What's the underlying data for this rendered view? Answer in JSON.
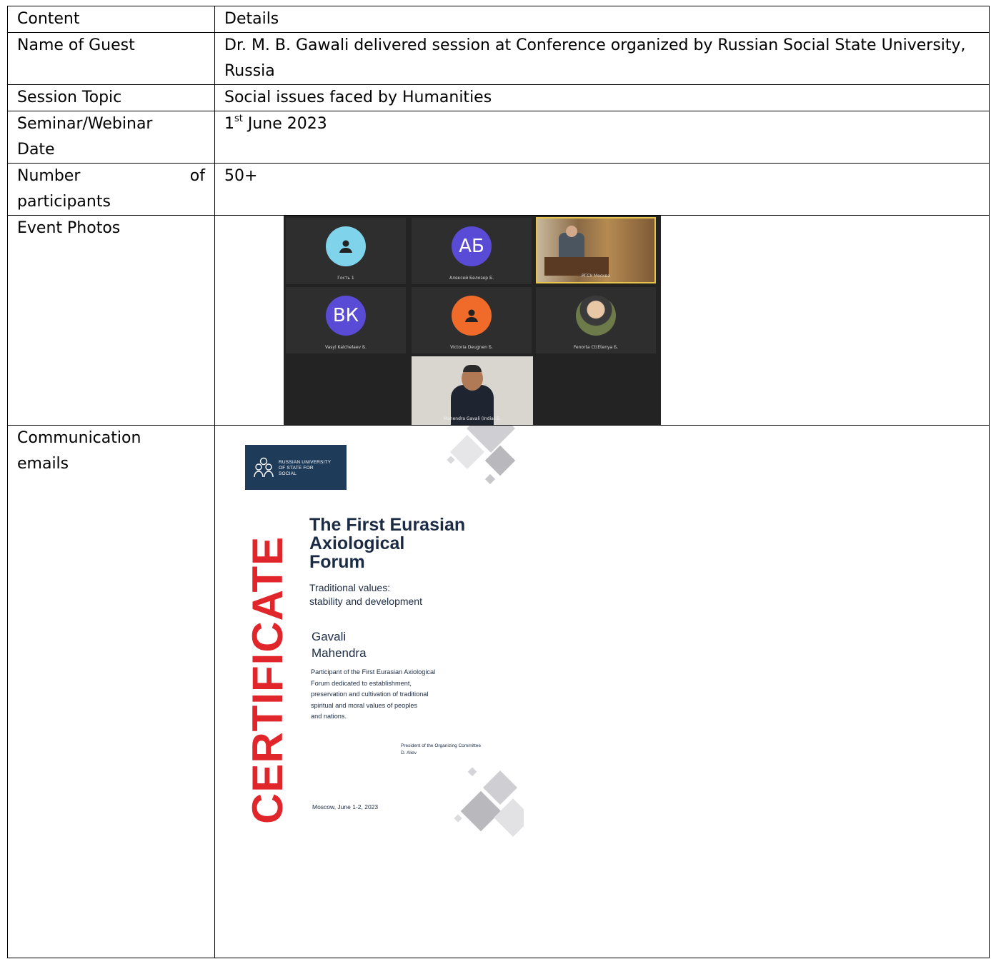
{
  "table": {
    "header": {
      "left": "Content",
      "right": "Details"
    },
    "guest": {
      "label": "Name of Guest",
      "value": "Dr. M. B. Gawali delivered session at Conference organized by Russian Social State University, Russia"
    },
    "topic": {
      "label": "Session Topic",
      "value": "Social issues faced by Humanities"
    },
    "date": {
      "label_line1": "Seminar/Webinar",
      "label_line2": "Date",
      "day": "1",
      "suffix": "st",
      "rest": " June 2023"
    },
    "participants": {
      "label_word1": "Number",
      "label_word2": "of",
      "label_line2": "participants",
      "value": "50+"
    },
    "photos": {
      "label": "Event Photos"
    },
    "emails": {
      "label_line1": "Communication",
      "label_line2": "emails"
    }
  },
  "zoom": {
    "tiles": [
      {
        "initials": "",
        "color": "#7fd4ec",
        "icon": "person-icon",
        "caption": "Гость 1"
      },
      {
        "initials": "АБ",
        "color": "#5a4bd6",
        "icon": "",
        "caption": "Алексей Белозер Б."
      },
      {
        "initials": "",
        "color": "",
        "icon": "video",
        "caption": "РГСУ Москва"
      },
      {
        "initials": "ВК",
        "color": "#5a4bd6",
        "icon": "",
        "caption": "Vasyl Kalchelaev Б."
      },
      {
        "initials": "",
        "color": "#f06a2a",
        "icon": "person-icon",
        "caption": "Victoria Deugnen Б."
      },
      {
        "initials": "",
        "color": "",
        "icon": "photo",
        "caption": "Fenorta Ct(Etenya Б."
      },
      {
        "initials": "",
        "color": "",
        "icon": "video",
        "caption": "Mahendra Gavali (India) Б."
      }
    ]
  },
  "certificate": {
    "logo_text_1": "RUSSIAN UNIVERSITY",
    "logo_text_2": "OF STATE FOR",
    "logo_text_3": "SOCIAL",
    "vertical_title": "CERTIFICATE",
    "title_1": "The First Eurasian",
    "title_2": "Axiological",
    "title_3": "Forum",
    "subtitle_1": "Traditional values:",
    "subtitle_2": "stability and development",
    "name_1": "Gavali",
    "name_2": "Mahendra",
    "desc_1": "Participant of the First Eurasian Axiological",
    "desc_2": "Forum dedicated to establishment,",
    "desc_3": "preservation and cultivation of traditional",
    "desc_4": "spiritual and moral values of peoples",
    "desc_5": "and nations.",
    "president_1": "President of the Organizing Committee",
    "president_2": "D. Aliev",
    "place": "Moscow, June 1-2, 2023",
    "accent": "#e0252b",
    "navy": "#1f3b5a"
  }
}
